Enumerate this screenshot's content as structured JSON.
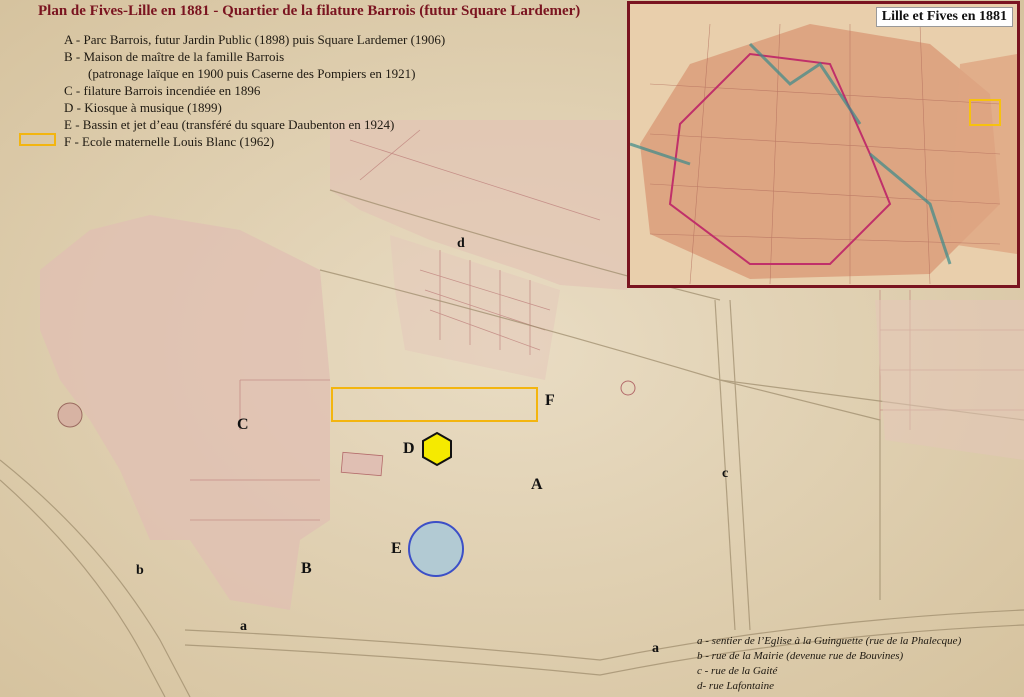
{
  "title": "Plan de Fives-Lille en 1881 - Quartier de la filature Barrois (futur Square Lardemer)",
  "legend": {
    "items": [
      "A - Parc Barrois, futur Jardin Public (1898) puis Square Lardemer (1906)",
      "B - Maison de maître de la famille Barrois",
      "(patronage laïque en 1900 puis Caserne des Pompiers en 1921)",
      "C - filature Barrois incendiée en 1896",
      "D - Kiosque à musique (1899)",
      "E - Bassin et jet d’eau (transféré du square Daubenton en 1924)",
      "F - Ecole maternelle Louis Blanc (1962)"
    ]
  },
  "labels": {
    "A": "A",
    "B": "B",
    "C": "C",
    "D": "D",
    "E": "E",
    "F": "F",
    "a1": "a",
    "a2": "a",
    "b": "b",
    "c": "c",
    "d": "d"
  },
  "street_legend": [
    "a - sentier de l’Eglise à la Guinguette (rue de la Phalecque)",
    "b - rue de la Mairie (devenue rue de Bouvines)",
    "c - rue de la Gaité",
    "d- rue Lafontaine"
  ],
  "inset": {
    "title": "Lille et Fives en 1881"
  },
  "colors": {
    "title": "#7a1420",
    "highlight_yellow": "#f3b50f",
    "kiosk_fill": "#f5ea00",
    "basin_fill": "#a9c9d8",
    "basin_stroke": "#3c4fc7",
    "paper": "#e6d9bf",
    "parcel": "#e3c2b5"
  }
}
